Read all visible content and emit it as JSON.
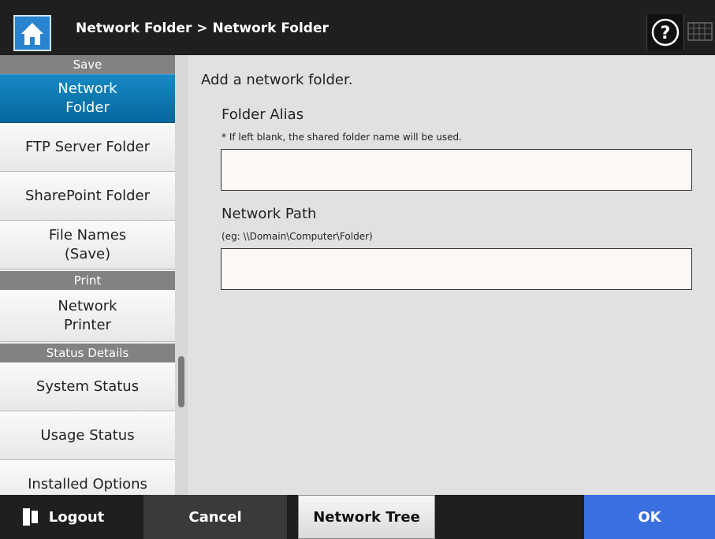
{
  "header": {
    "breadcrumb": "Network Folder > Network Folder",
    "home_icon": "home-icon",
    "help_icon": "help-icon",
    "keyboard_icon": "keyboard-icon"
  },
  "sidebar": {
    "sections": [
      {
        "label": "Save"
      },
      {
        "label": "Print"
      },
      {
        "label": "Status Details"
      }
    ],
    "items": [
      {
        "label": "Network\nFolder",
        "active": true
      },
      {
        "label": "FTP Server Folder"
      },
      {
        "label": "SharePoint Folder"
      },
      {
        "label": "File Names\n(Save)"
      },
      {
        "label": "Network\nPrinter"
      },
      {
        "label": "System Status"
      },
      {
        "label": "Usage Status"
      },
      {
        "label": "Installed Options"
      }
    ]
  },
  "main": {
    "heading": "Add a network folder.",
    "alias": {
      "label": "Folder Alias",
      "hint": "* If left blank, the shared folder name will be used.",
      "value": ""
    },
    "path": {
      "label": "Network Path",
      "hint": "(eg: \\\\Domain\\Computer\\Folder)",
      "value": ""
    }
  },
  "footer": {
    "logout": "Logout",
    "cancel": "Cancel",
    "network_tree": "Network Tree",
    "ok": "OK"
  },
  "colors": {
    "accent": "#0a70a8",
    "ok_button": "#3a6fe0",
    "header": "#1f1f1f"
  }
}
